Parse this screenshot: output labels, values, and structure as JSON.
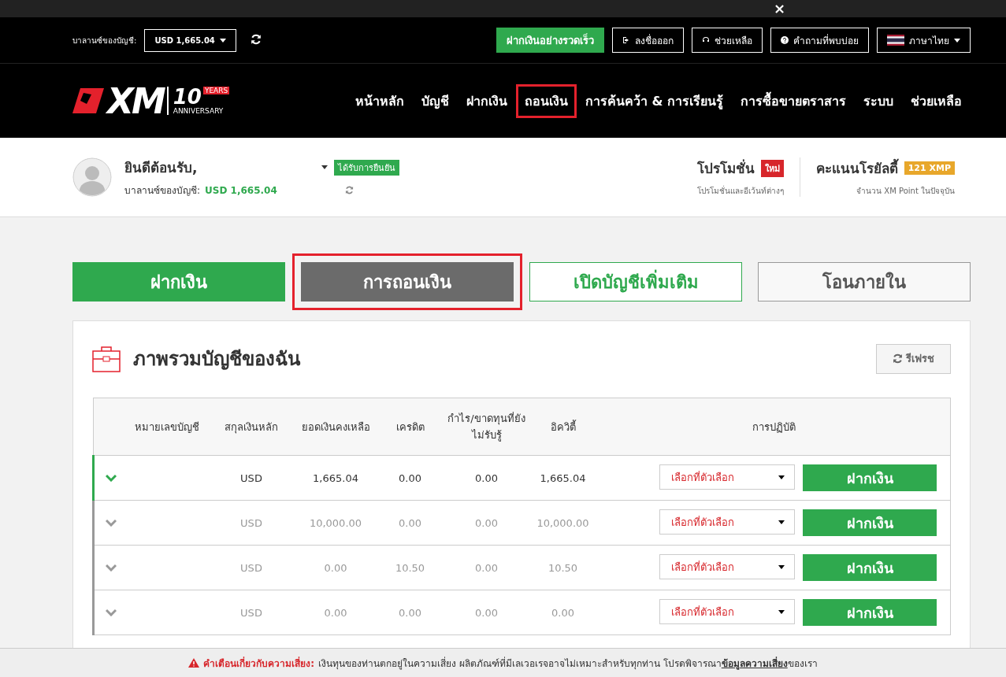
{
  "top_banner": {
    "close": "×"
  },
  "account_bar": {
    "balance_label": "บาลานซ์ของบัญชี:",
    "balance_value": "USD 1,665.04",
    "buttons": [
      {
        "label": "ฝากเงินอย่างรวดเร็ว",
        "kind": "primary"
      },
      {
        "label": "ลงชื่อออก",
        "kind": "logout"
      },
      {
        "label": "ช่วยเหลือ",
        "kind": "help"
      },
      {
        "label": "คำถามที่พบบ่อย",
        "kind": "faq"
      },
      {
        "label": "ภาษาไทย",
        "kind": "language"
      }
    ]
  },
  "logo": {
    "text": "XM",
    "badge": "10",
    "years": "YEARS",
    "anniversary": "ANNIVERSARY"
  },
  "nav": [
    {
      "label": "หน้าหลัก",
      "selected": false
    },
    {
      "label": "บัญชี",
      "selected": false
    },
    {
      "label": "ฝากเงิน",
      "selected": false
    },
    {
      "label": "ถอนเงิน",
      "selected": true
    },
    {
      "label": "การค้นคว้า & การเรียนรู้",
      "selected": false
    },
    {
      "label": "การซื้อขายตราสาร",
      "selected": false
    },
    {
      "label": "ระบบ",
      "selected": false
    },
    {
      "label": "ช่วยเหลือ",
      "selected": false
    }
  ],
  "profile": {
    "welcome": "ยินดีต้อนรับ,",
    "verified": "ได้รับการยืนยัน",
    "balance_label": "บาลานซ์ของบัญชี:",
    "balance_value": "USD 1,665.04"
  },
  "promotions": {
    "title": "โปรโมชั่น",
    "badge": "ใหม่",
    "subtitle": "โปรโมชั่นและอีเว้นท์ต่างๆ"
  },
  "loyalty": {
    "title": "คะแนนโรยัลตี้",
    "badge": "121 XMP",
    "subtitle": "จำนวน XM Point ในปัจจุบัน"
  },
  "tabs": [
    {
      "label": "ฝากเงิน",
      "kind": "primary",
      "selected": false
    },
    {
      "label": "การถอนเงิน",
      "kind": "dark",
      "selected": true
    },
    {
      "label": "เปิดบัญชีเพิ่มเติม",
      "kind": "outline",
      "selected": false
    },
    {
      "label": "โอนภายใน",
      "kind": "plain",
      "selected": false
    }
  ],
  "panel": {
    "title": "ภาพรวมบัญชีของฉัน",
    "refresh": "รีเฟรช"
  },
  "table": {
    "columns": [
      "หมายเลขบัญชี",
      "สกุลเงินหลัก",
      "ยอดเงินคงเหลือ",
      "เครดิต",
      "กำไร/ขาดทุนที่ยังไม่รับรู้",
      "อิควิตี้",
      "การปฏิบัติ"
    ],
    "rows": [
      {
        "selected": true,
        "currency": "USD",
        "balance": "1,665.04",
        "credit": "0.00",
        "pnl": "0.00",
        "equity": "1,665.04",
        "action": "เลือกที่ตัวเลือก",
        "button": "ฝากเงิน"
      },
      {
        "selected": false,
        "currency": "USD",
        "balance": "10,000.00",
        "credit": "0.00",
        "pnl": "0.00",
        "equity": "10,000.00",
        "action": "เลือกที่ตัวเลือก",
        "button": "ฝากเงิน"
      },
      {
        "selected": false,
        "currency": "USD",
        "balance": "0.00",
        "credit": "10.50",
        "pnl": "0.00",
        "equity": "10.50",
        "action": "เลือกที่ตัวเลือก",
        "button": "ฝากเงิน"
      },
      {
        "selected": false,
        "currency": "USD",
        "balance": "0.00",
        "credit": "0.00",
        "pnl": "0.00",
        "equity": "0.00",
        "action": "เลือกที่ตัวเลือก",
        "button": "ฝากเงิน"
      }
    ]
  },
  "risk_warning": {
    "label": "คำเตือนเกี่ยวกับความเสี่ยง:",
    "text": "เงินทุนของท่านตกอยู่ในความเสี่ยง ผลิตภัณฑ์ที่มีเลเวอเรจอาจไม่เหมาะสำหรับทุกท่าน โปรดพิจารณา",
    "link": "ข้อมูลความเสี่ยง",
    "tail": "ของเรา"
  }
}
